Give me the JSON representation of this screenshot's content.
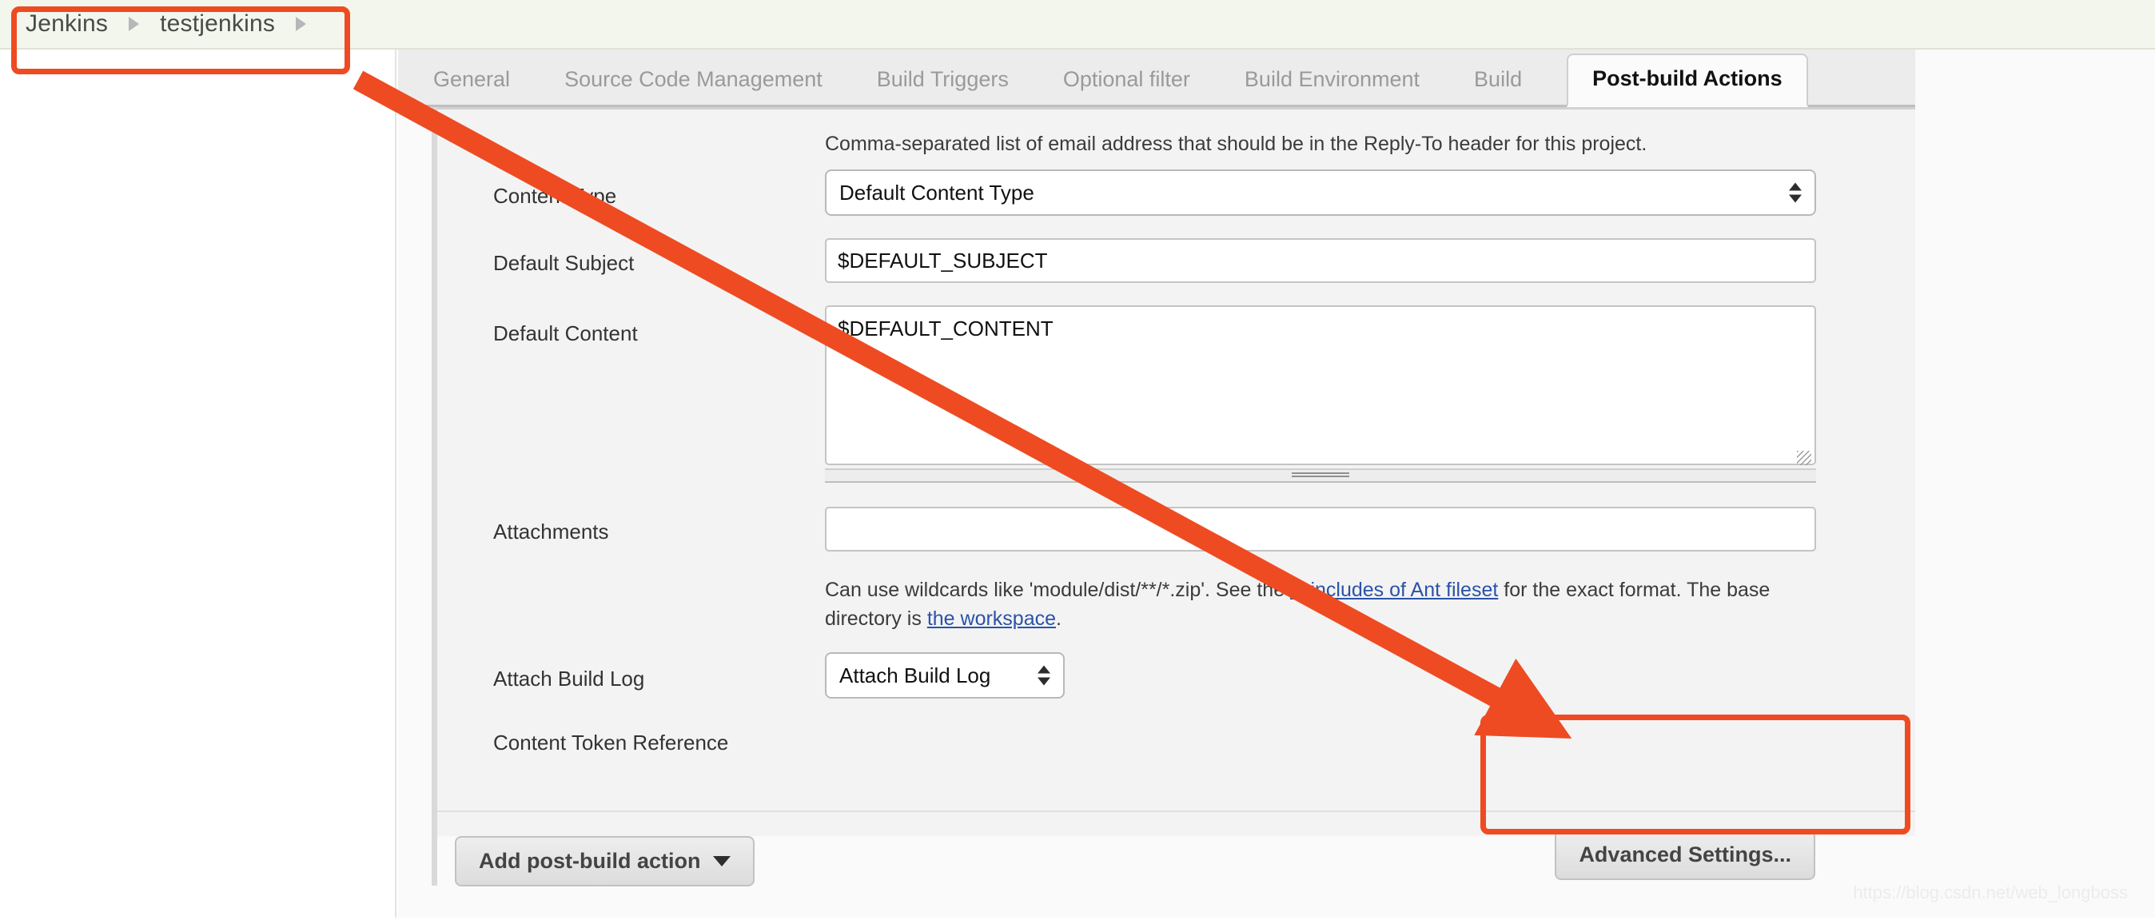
{
  "breadcrumb": {
    "items": [
      {
        "label": "Jenkins"
      },
      {
        "label": "testjenkins"
      }
    ],
    "separator_icon": "chevron-right-icon"
  },
  "tabs": [
    {
      "label": "General",
      "active": false
    },
    {
      "label": "Source Code Management",
      "active": false
    },
    {
      "label": "Build Triggers",
      "active": false
    },
    {
      "label": "Optional filter",
      "active": false
    },
    {
      "label": "Build Environment",
      "active": false
    },
    {
      "label": "Build",
      "active": false
    },
    {
      "label": "Post-build Actions",
      "active": true
    }
  ],
  "form": {
    "reply_to_description": "Comma-separated list of email address that should be in the Reply-To header for this project.",
    "content_type": {
      "label": "Content Type",
      "value": "Default Content Type",
      "options": [
        "Default Content Type"
      ]
    },
    "default_subject": {
      "label": "Default Subject",
      "value": "$DEFAULT_SUBJECT",
      "placeholder": ""
    },
    "default_content": {
      "label": "Default Content",
      "value": "$DEFAULT_CONTENT",
      "placeholder": ""
    },
    "attachments": {
      "label": "Attachments",
      "value": "",
      "placeholder": "",
      "description_part1": "Can use wildcards like 'module/dist/**/*.zip'. See the ",
      "description_link1": "@includes of Ant fileset",
      "description_part2": " for the exact format. The base directory is ",
      "description_link2": "the workspace",
      "description_part3": "."
    },
    "attach_build_log": {
      "label": "Attach Build Log",
      "value": "Attach Build Log",
      "options": [
        "Attach Build Log"
      ]
    },
    "content_token_reference": {
      "label": "Content Token Reference"
    },
    "help_icon_label": "?",
    "help_icon_name": "help-icon"
  },
  "buttons": {
    "advanced_settings": "Advanced Settings...",
    "add_post_build_action": "Add post-build action"
  },
  "annotations": {
    "accent_color": "#ee4b22",
    "arrow_name": "callout-arrow",
    "box_breadcrumb_name": "callout-box-breadcrumb",
    "box_advanced_name": "callout-box-advanced-settings"
  },
  "watermark": {
    "text": "https://blog.csdn.net/web_longboss"
  },
  "colors": {
    "breadcrumb_bg": "#f3f6ec",
    "tab_bar_bg": "#ececec",
    "panel_bg": "#f3f3f3",
    "link": "#2b52a8",
    "accent": "#ee4b22"
  }
}
